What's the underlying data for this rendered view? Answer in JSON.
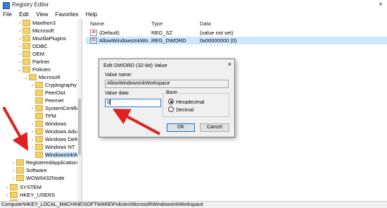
{
  "window": {
    "title": "Registry Editor",
    "close_glyph": "×"
  },
  "menu": [
    "File",
    "Edit",
    "View",
    "Favorites",
    "Help"
  ],
  "tree": [
    {
      "label": "Maxthon3",
      "arrow": "›"
    },
    {
      "label": "Microsoft",
      "arrow": "›"
    },
    {
      "label": "MozillaPlugins",
      "arrow": "›"
    },
    {
      "label": "ODBC",
      "arrow": "›"
    },
    {
      "label": "OEM",
      "arrow": "›"
    },
    {
      "label": "Partner",
      "arrow": "›"
    },
    {
      "label": "Policies",
      "arrow": "⌄"
    },
    {
      "label": "Microsoft",
      "arrow": "⌄"
    },
    {
      "label": "Cryptography",
      "arrow": "›"
    },
    {
      "label": "PeerDist",
      "arrow": ""
    },
    {
      "label": "Peernet",
      "arrow": ""
    },
    {
      "label": "SystemCertificates",
      "arrow": "›"
    },
    {
      "label": "TPM",
      "arrow": ""
    },
    {
      "label": "Windows",
      "arrow": "›"
    },
    {
      "label": "Windows Advanced",
      "arrow": "›"
    },
    {
      "label": "Windows Defender",
      "arrow": "›"
    },
    {
      "label": "Windows NT",
      "arrow": "›"
    },
    {
      "label": "WindowsInkWorksp",
      "arrow": ""
    },
    {
      "label": "RegisteredApplications",
      "arrow": "›"
    },
    {
      "label": "Software",
      "arrow": "›"
    },
    {
      "label": "WOW6432Node",
      "arrow": "›"
    },
    {
      "label": "SYSTEM",
      "arrow": "›"
    },
    {
      "label": "HKEY_USERS",
      "arrow": "›"
    },
    {
      "label": "HKEY_CURRENT_CONFIG",
      "arrow": "›"
    }
  ],
  "list": {
    "headers": {
      "name": "Name",
      "type": "Type",
      "data": "Data"
    },
    "rows": [
      {
        "name": "(Default)",
        "type": "REG_SZ",
        "data": "(value not set)",
        "icon": "ab"
      },
      {
        "name": "AllowWindowsInkWo...",
        "type": "REG_DWORD",
        "data": "0x00000000 (0)",
        "icon": "01"
      }
    ]
  },
  "dialog": {
    "title": "Edit DWORD (32-bit) Value",
    "close_glyph": "×",
    "value_name_label": "Value name:",
    "value_name": "AllowWindowsInkWorkspace",
    "value_data_label": "Value data:",
    "value_data": "0",
    "base_label": "Base",
    "hex_label": "Hexadecimal",
    "dec_label": "Decimal",
    "ok_label": "OK",
    "cancel_label": "Cancel"
  },
  "status": "Computer\\HKEY_LOCAL_MACHINE\\SOFTWARE\\Policies\\Microsoft\\WindowsInkWorkspace",
  "colors": {
    "accent": "#0078d7",
    "annotation_arrow": "#e0201e",
    "selection": "#cce8ff"
  }
}
